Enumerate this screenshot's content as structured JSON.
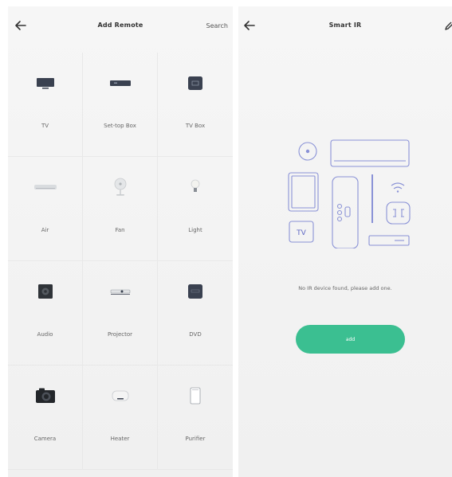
{
  "left_screen": {
    "title": "Add Remote",
    "search_label": "Search",
    "devices": [
      {
        "label": "TV",
        "icon": "tv-icon"
      },
      {
        "label": "Set-top Box",
        "icon": "set-top-box-icon"
      },
      {
        "label": "TV Box",
        "icon": "tv-box-icon"
      },
      {
        "label": "Air",
        "icon": "air-conditioner-icon"
      },
      {
        "label": "Fan",
        "icon": "fan-icon"
      },
      {
        "label": "Light",
        "icon": "light-bulb-icon"
      },
      {
        "label": "Audio",
        "icon": "audio-speaker-icon"
      },
      {
        "label": "Projector",
        "icon": "projector-icon"
      },
      {
        "label": "DVD",
        "icon": "dvd-icon"
      },
      {
        "label": "Camera",
        "icon": "camera-icon"
      },
      {
        "label": "Heater",
        "icon": "heater-icon"
      },
      {
        "label": "Purifier",
        "icon": "purifier-icon"
      }
    ]
  },
  "right_screen": {
    "title": "Smart IR",
    "illustration_tv_text": "TV",
    "empty_message": "No IR device found, please add one.",
    "add_label": "add"
  },
  "colors": {
    "accent": "#3bbf91",
    "illustration_stroke": "#8a92d6"
  }
}
